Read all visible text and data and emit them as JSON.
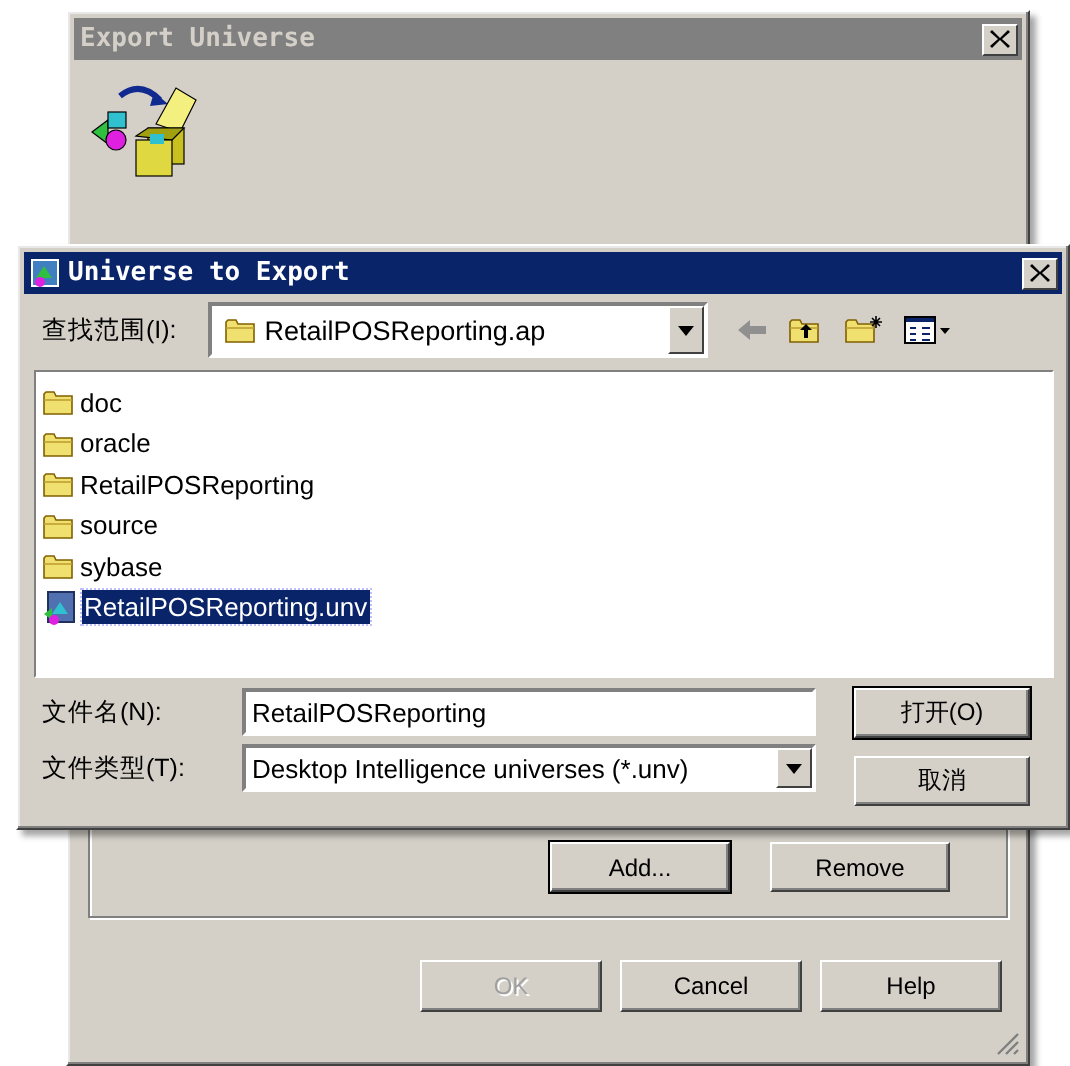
{
  "export_window": {
    "title": "Export Universe",
    "active": false,
    "group_buttons": [
      {
        "label": "Add...",
        "disabled": false,
        "default": true
      },
      {
        "label": "Remove",
        "disabled": false,
        "default": false
      }
    ],
    "footer_buttons": [
      {
        "label": "OK",
        "disabled": true,
        "default": false
      },
      {
        "label": "Cancel",
        "disabled": false,
        "default": false
      },
      {
        "label": "Help",
        "disabled": false,
        "default": false
      }
    ]
  },
  "open_dialog": {
    "title": "Universe to Export",
    "active": true,
    "look_in": {
      "label": "查找范围(I):",
      "value": "RetailPOSReporting.ap"
    },
    "files": [
      {
        "name": "doc",
        "kind": "folder",
        "selected": false
      },
      {
        "name": "oracle",
        "kind": "folder",
        "selected": false
      },
      {
        "name": "RetailPOSReporting",
        "kind": "folder",
        "selected": false
      },
      {
        "name": "source",
        "kind": "folder",
        "selected": false
      },
      {
        "name": "sybase",
        "kind": "folder",
        "selected": false
      },
      {
        "name": "RetailPOSReporting.unv",
        "kind": "universe",
        "selected": true
      }
    ],
    "file_name": {
      "label": "文件名(N):",
      "value": "RetailPOSReporting"
    },
    "file_type": {
      "label": "文件类型(T):",
      "value": "Desktop Intelligence universes (*.unv)"
    },
    "buttons": [
      {
        "label": "打开(O)",
        "disabled": false,
        "default": true
      },
      {
        "label": "取消",
        "disabled": false,
        "default": false
      }
    ]
  }
}
